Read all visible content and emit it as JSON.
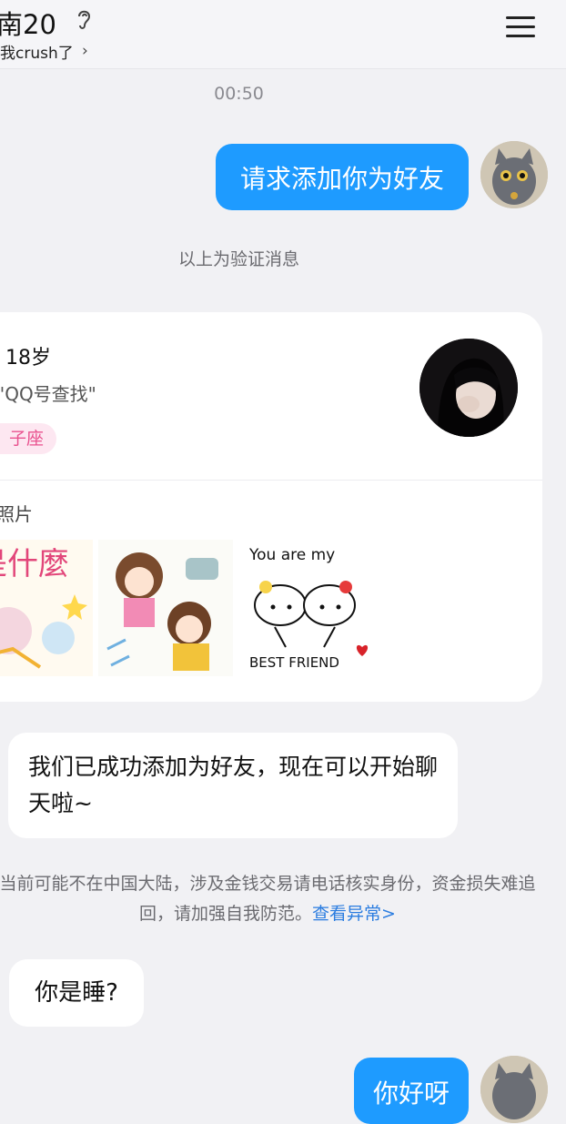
{
  "header": {
    "title": "南20",
    "subtitle": "我crush了",
    "chevron": "›"
  },
  "icons": {
    "ear": "ear-icon",
    "menu": "menu-icon",
    "chevron": "chevron-right-icon"
  },
  "messages": {
    "time": "00:50",
    "request": "请求添加你为好友",
    "verify_note": "以上为验证消息",
    "added": "我们已成功添加为好友，现在可以开始聊天啦~",
    "sleep": "你是睡?",
    "last": "你好呀"
  },
  "card": {
    "age": "18岁",
    "source": "\"QQ号查找\"",
    "tag": "子座",
    "photos_label": "照片"
  },
  "warning": {
    "text": "当前可能不在中国大陆，涉及金钱交易请电话核实身份，资金损失难追回，请加强自我防范。",
    "link": "查看异常>"
  },
  "photo_text": {
    "p1": "是什麼",
    "p3_top": "You are my",
    "p3_bottom": "BEST FRIEND"
  },
  "colors": {
    "accent": "#1e9bff",
    "background": "#f1f1f4",
    "tag_pink": "#e9528f",
    "link": "#2b7de0"
  }
}
